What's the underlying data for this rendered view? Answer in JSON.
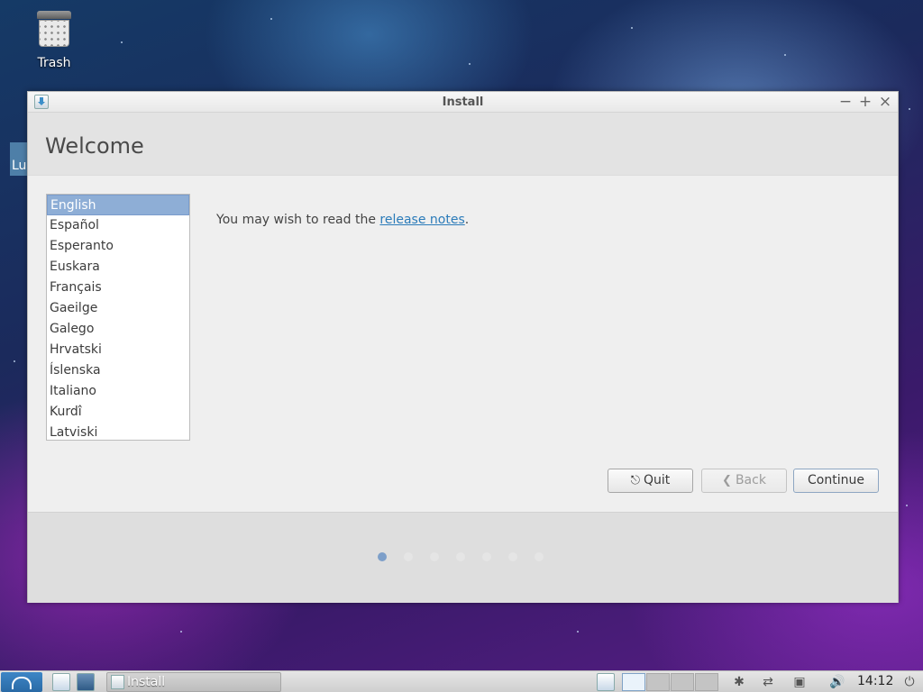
{
  "desktop": {
    "trash_label": "Trash",
    "left_tab_label": "Lu"
  },
  "window": {
    "title": "Install",
    "controls": {
      "minimize": "−",
      "maximize": "+",
      "close": "×"
    },
    "page_title": "Welcome",
    "languages": [
      "English",
      "Español",
      "Esperanto",
      "Euskara",
      "Français",
      "Gaeilge",
      "Galego",
      "Hrvatski",
      "Íslenska",
      "Italiano",
      "Kurdî",
      "Latviski"
    ],
    "selected_language": "English",
    "release_text_prefix": "You may wish to read the ",
    "release_link": "release notes",
    "release_text_suffix": ".",
    "buttons": {
      "quit": "Quit",
      "back": "Back",
      "continue": "Continue"
    },
    "progress": {
      "total_steps": 7,
      "current_step": 1
    }
  },
  "taskbar": {
    "task_label": "Install",
    "clock": "14:12"
  }
}
